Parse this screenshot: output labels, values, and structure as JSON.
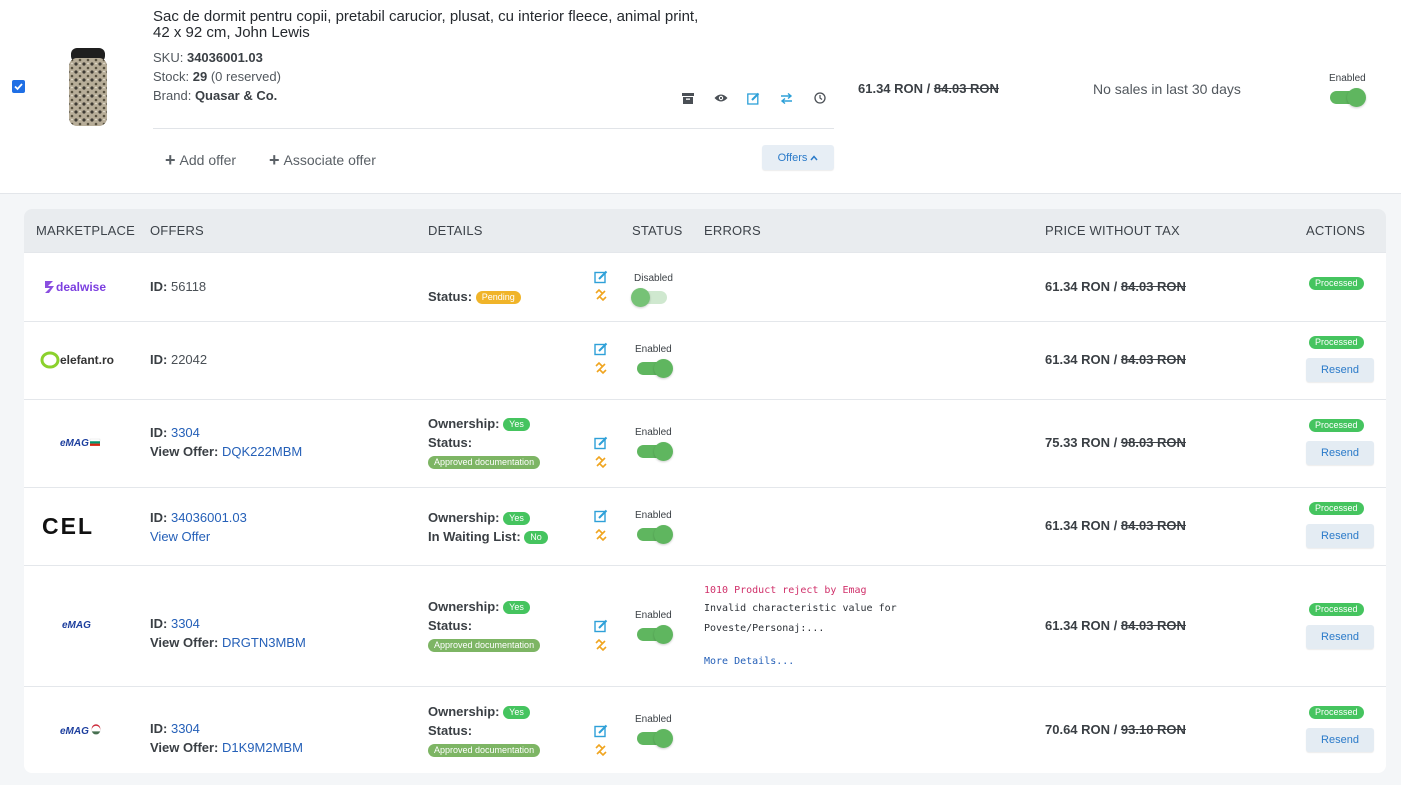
{
  "product": {
    "title_line1": "Sac de dormit pentru copii, pretabil carucior, plusat, cu interior fleece, animal print,",
    "title_line2": "42 x 92 cm, John Lewis",
    "sku_label": "SKU:",
    "sku": "34036001.03",
    "stock_label": "Stock:",
    "stock": "29",
    "stock_reserved": "(0 reserved)",
    "brand_label": "Brand:",
    "brand": "Quasar & Co.",
    "price": "61.34 RON /",
    "old_price": "84.03 RON",
    "sales_text": "No sales in last 30 days",
    "status_label": "Enabled",
    "status_enabled": true,
    "add_offer": "Add offer",
    "associate_offer": "Associate offer",
    "offers_button": "Offers"
  },
  "icons": {
    "archive": "archive-icon",
    "view": "eye-icon",
    "edit": "edit-icon",
    "transfer": "transfer-icon",
    "history": "clock-icon",
    "unlink": "unlink-icon",
    "plus": "plus-icon",
    "chevron": "chevron-up-icon",
    "checkbox": "checkbox-checked-icon"
  },
  "colors": {
    "toggle_on": "#5fb65f",
    "badge_green": "#45c45f",
    "badge_olive": "#7db564",
    "badge_orange": "#f0b429",
    "link": "#2560b8",
    "error_code": "#d0306a"
  },
  "table": {
    "headers": {
      "marketplace": "MARKETPLACE",
      "offers": "OFFERS",
      "details": "DETAILS",
      "status": "STATUS",
      "errors": "ERRORS",
      "price": "PRICE WITHOUT TAX",
      "actions": "ACTIONS"
    },
    "rows": [
      {
        "marketplace": "dealwise",
        "id_label": "ID:",
        "id": "56118",
        "status_label": "Status:",
        "status_badge": "Pending",
        "toggle_label": "Disabled",
        "enabled": false,
        "price": "61.34 RON /",
        "old_price": "84.03 RON",
        "action_badge": "Processed"
      },
      {
        "marketplace": "elefant.ro",
        "id_label": "ID:",
        "id": "22042",
        "toggle_label": "Enabled",
        "enabled": true,
        "price": "61.34 RON /",
        "old_price": "84.03 RON",
        "action_badge": "Processed",
        "resend": "Resend"
      },
      {
        "marketplace": "eMAG",
        "id_label": "ID:",
        "id": "3304",
        "view_label": "View Offer:",
        "view_value": "DQK222MBM",
        "ownership_label": "Ownership:",
        "ownership": "Yes",
        "status_label": "Status:",
        "status_badge": "Approved documentation",
        "toggle_label": "Enabled",
        "enabled": true,
        "price": "75.33 RON /",
        "old_price": "98.03 RON",
        "action_badge": "Processed",
        "resend": "Resend"
      },
      {
        "marketplace": "CEL",
        "id_label": "ID:",
        "id": "34036001.03",
        "view_link": "View Offer",
        "ownership_label": "Ownership:",
        "ownership": "Yes",
        "waiting_label": "In Waiting List:",
        "waiting": "No",
        "toggle_label": "Enabled",
        "enabled": true,
        "price": "61.34 RON /",
        "old_price": "84.03 RON",
        "action_badge": "Processed",
        "resend": "Resend"
      },
      {
        "marketplace": "eMAG",
        "id_label": "ID:",
        "id": "3304",
        "view_label": "View Offer:",
        "view_value": "DRGTN3MBM",
        "ownership_label": "Ownership:",
        "ownership": "Yes",
        "status_label": "Status:",
        "status_badge": "Approved documentation",
        "toggle_label": "Enabled",
        "enabled": true,
        "error_code": "1010 Product reject by Emag",
        "error_line1": "Invalid characteristic value for",
        "error_line2": "Poveste/Personaj:...",
        "error_more": "More Details...",
        "price": "61.34 RON /",
        "old_price": "84.03 RON",
        "action_badge": "Processed",
        "resend": "Resend"
      },
      {
        "marketplace": "eMAG",
        "id_label": "ID:",
        "id": "3304",
        "view_label": "View Offer:",
        "view_value": "D1K9M2MBM",
        "ownership_label": "Ownership:",
        "ownership": "Yes",
        "status_label": "Status:",
        "status_badge": "Approved documentation",
        "toggle_label": "Enabled",
        "enabled": true,
        "price": "70.64 RON /",
        "old_price": "93.10 RON",
        "action_badge": "Processed",
        "resend": "Resend"
      }
    ]
  }
}
